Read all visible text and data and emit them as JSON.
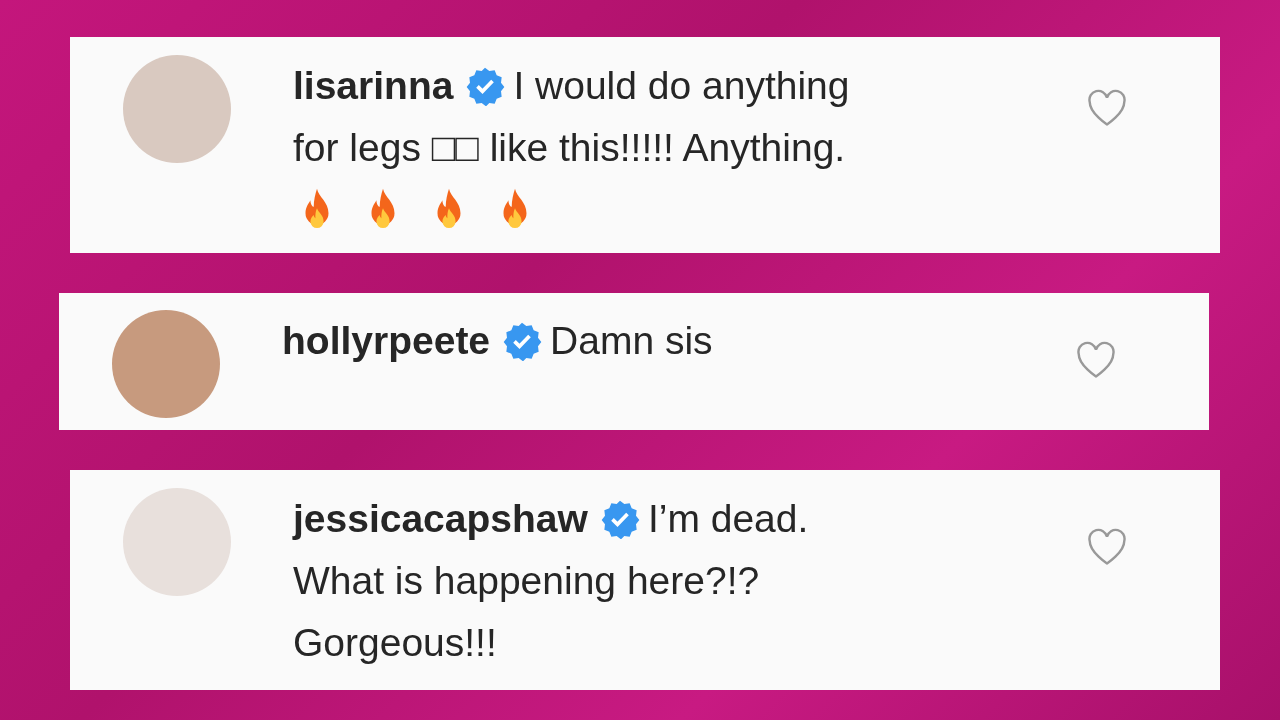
{
  "comments": [
    {
      "username": "lisarinna",
      "verified": true,
      "text_lines": [
        "I would do anything",
        "for legs □□ like this!!!!! Anything."
      ],
      "emoji": [
        {
          "kind": "fire"
        },
        {
          "kind": "fire"
        },
        {
          "kind": "fire"
        },
        {
          "kind": "fire"
        }
      ],
      "liked": false
    },
    {
      "username": "hollyrpeete",
      "verified": true,
      "text_lines": [
        "Damn sis"
      ],
      "liked": false
    },
    {
      "username": "jessicacapshaw",
      "verified": true,
      "text_lines": [
        "I’m dead.",
        "What is happening here?!?",
        "Gorgeous!!!"
      ],
      "liked": false
    }
  ]
}
